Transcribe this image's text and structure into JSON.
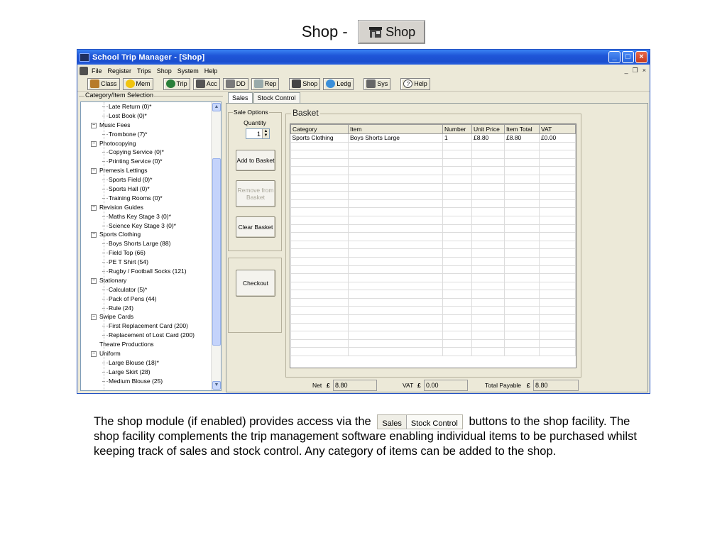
{
  "slide_title": "Shop -",
  "shop_badge_label": "Shop",
  "window": {
    "title": "School Trip Manager - [Shop]",
    "menu": [
      "File",
      "Register",
      "Trips",
      "Shop",
      "System",
      "Help"
    ],
    "toolbar": [
      "Class",
      "Mem",
      "Trip",
      "Acc",
      "DD",
      "Rep",
      "Shop",
      "Ledg",
      "Sys",
      "Help"
    ]
  },
  "tree": {
    "label": "Category/Item Selection",
    "rows": [
      {
        "level": 1,
        "text": "Late Return (0)*"
      },
      {
        "level": 1,
        "text": "Lost Book (0)*"
      },
      {
        "level": 0,
        "text": "Music Fees"
      },
      {
        "level": 1,
        "text": "Trombone (7)*"
      },
      {
        "level": 0,
        "text": "Photocopying"
      },
      {
        "level": 1,
        "text": "Copying Service (0)*"
      },
      {
        "level": 1,
        "text": "Printing Service (0)*"
      },
      {
        "level": 0,
        "text": "Premesis Lettings"
      },
      {
        "level": 1,
        "text": "Sports Field (0)*"
      },
      {
        "level": 1,
        "text": "Sports Hall (0)*"
      },
      {
        "level": 1,
        "text": "Training Rooms (0)*"
      },
      {
        "level": 0,
        "text": "Revision Guides"
      },
      {
        "level": 1,
        "text": "Maths Key Stage 3 (0)*"
      },
      {
        "level": 1,
        "text": "Science Key Stage 3 (0)*"
      },
      {
        "level": 0,
        "text": "Sports Clothing"
      },
      {
        "level": 1,
        "text": "Boys Shorts Large (88)"
      },
      {
        "level": 1,
        "text": "Field Top (66)"
      },
      {
        "level": 1,
        "text": "PE T Shirt (54)"
      },
      {
        "level": 1,
        "text": "Rugby / Football Socks (121)"
      },
      {
        "level": 0,
        "text": "Stationary"
      },
      {
        "level": 1,
        "text": "Calculator (5)*"
      },
      {
        "level": 1,
        "text": "Pack of Pens (44)"
      },
      {
        "level": 1,
        "text": "Rule (24)"
      },
      {
        "level": 0,
        "text": "Swipe Cards"
      },
      {
        "level": 1,
        "text": "First Replacement Card (200)"
      },
      {
        "level": 1,
        "text": "Replacement of Lost Card (200)"
      },
      {
        "level": 0,
        "text": "Theatre Productions",
        "leaf": true
      },
      {
        "level": 0,
        "text": "Uniform"
      },
      {
        "level": 1,
        "text": "Large Blouse (18)*"
      },
      {
        "level": 1,
        "text": "Large Skirt (28)"
      },
      {
        "level": 1,
        "text": "Medium Blouse (25)"
      }
    ]
  },
  "tabs": [
    "Sales",
    "Stock Control"
  ],
  "sale_options": {
    "label": "Sale Options",
    "quantity_label": "Quantity",
    "quantity_value": "1",
    "add_label": "Add to Basket",
    "remove_label": "Remove from Basket",
    "clear_label": "Clear Basket",
    "checkout_label": "Checkout"
  },
  "basket": {
    "label": "Basket",
    "columns": [
      "Category",
      "Item",
      "Number",
      "Unit Price",
      "Item Total",
      "VAT"
    ],
    "rows": [
      [
        "Sports Clothing",
        "Boys Shorts Large",
        "1",
        "£8.80",
        "£8.80",
        "£0.00"
      ]
    ]
  },
  "totals": {
    "net_label": "Net",
    "net_value": "8.80",
    "vat_label": "VAT",
    "vat_value": "0.00",
    "total_label": "Total Payable",
    "total_value": "8.80",
    "currency": "£"
  },
  "caption": {
    "before": "The shop module (if enabled) provides access via the",
    "tab1": "Sales",
    "tab2": "Stock Control",
    "after": "buttons to the shop facility. The shop facility complements the trip management software enabling individual items to be purchased whilst keeping track of sales and stock control. Any category of items can be added to the shop."
  }
}
